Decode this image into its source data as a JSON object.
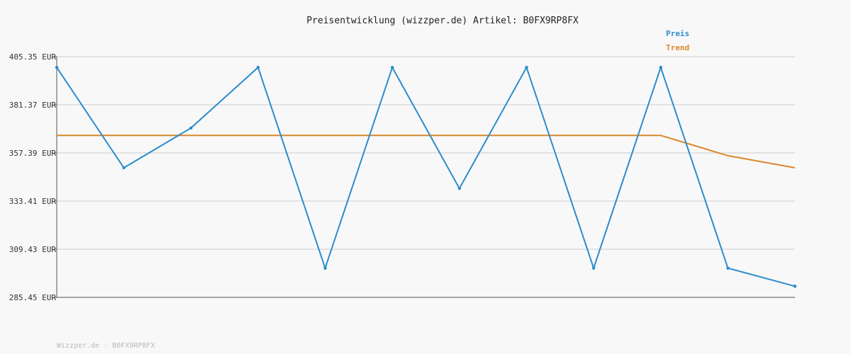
{
  "chart_data": {
    "type": "line",
    "title": "Preisentwicklung (wizzper.de) Artikel: B0FX9RP8FX",
    "xlabel": "",
    "ylabel": "",
    "ylim": [
      285.45,
      405.35
    ],
    "yticks": [
      "405.35 EUR",
      "381.37 EUR",
      "357.39 EUR",
      "333.41 EUR",
      "309.43 EUR",
      "285.45 EUR"
    ],
    "ytick_values": [
      405.35,
      381.37,
      357.39,
      333.41,
      309.43,
      285.45
    ],
    "grid": true,
    "legend_position": "top-right",
    "x": [
      0,
      1,
      2,
      3,
      4,
      5,
      6,
      7,
      8,
      9,
      10,
      11
    ],
    "series": [
      {
        "name": "Preis",
        "color": "#2b8ccc",
        "values": [
          400.0,
          350.0,
          369.8,
          400.0,
          300.0,
          400.0,
          339.7,
          400.0,
          300.0,
          400.0,
          300.0,
          291.0
        ]
      },
      {
        "name": "Trend",
        "color": "#d9892a",
        "values": [
          366.1,
          366.1,
          366.1,
          366.1,
          366.1,
          366.1,
          366.1,
          366.1,
          366.1,
          366.1,
          356.0,
          350.0
        ]
      }
    ]
  },
  "footer": "Wizzper.de - B0FX9RP8FX"
}
